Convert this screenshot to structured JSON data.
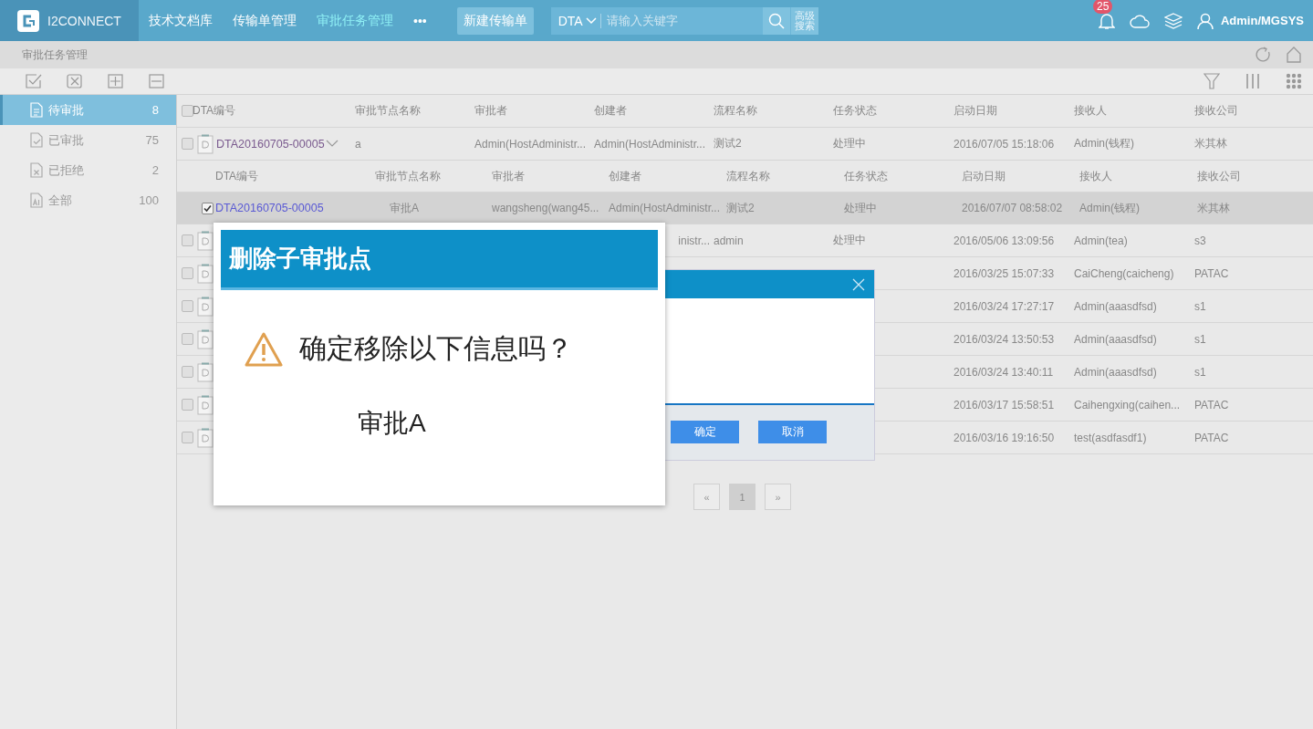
{
  "topbar": {
    "logo": "I2CONNECT",
    "nav": [
      {
        "label": "技术文档库",
        "selected": false
      },
      {
        "label": "传输单管理",
        "selected": false
      },
      {
        "label": "审批任务管理",
        "selected": true
      },
      {
        "label": "•••",
        "selected": false
      }
    ],
    "new_button": "新建传输单",
    "search": {
      "scope": "DTA",
      "placeholder": "请输入关键字",
      "advanced": "高级搜索"
    },
    "notification_count": "25",
    "user": "Admin/MGSYS"
  },
  "breadcrumb": "审批任务管理",
  "sidebar": {
    "items": [
      {
        "kind": "pending",
        "label": "待审批",
        "count": "8",
        "selected": true
      },
      {
        "kind": "approved",
        "label": "已审批",
        "count": "75",
        "selected": false
      },
      {
        "kind": "rejected",
        "label": "已拒绝",
        "count": "2",
        "selected": false
      },
      {
        "kind": "all",
        "label": "全部",
        "count": "100",
        "selected": false
      }
    ]
  },
  "table": {
    "select_all_checked": false,
    "columns": [
      "DTA编号",
      "审批节点名称",
      "审批者",
      "创建者",
      "流程名称",
      "任务状态",
      "启动日期",
      "接收人",
      "接收公司"
    ],
    "rows": [
      {
        "checked": false,
        "expanded": true,
        "id": "DTA20160705-00005",
        "node": "a",
        "approver": "Admin(HostAdministr...",
        "creator": "Admin(HostAdministr...",
        "process": "测试2",
        "status": "处理中",
        "date": "2016/07/05 15:18:06",
        "receiver": "Admin(钱程)",
        "company": "米其林",
        "detail": {
          "columns": [
            "DTA编号",
            "审批节点名称",
            "审批者",
            "创建者",
            "流程名称",
            "任务状态",
            "启动日期",
            "接收人",
            "接收公司"
          ],
          "rows": [
            {
              "checked": true,
              "selected": true,
              "id": "DTA20160705-00005",
              "node": "审批A",
              "approver": "wangsheng(wang45...",
              "creator": "Admin(HostAdministr...",
              "process": "测试2",
              "status": "处理中",
              "date": "2016/07/07 08:58:02",
              "receiver": "Admin(钱程)",
              "company": "米其林"
            }
          ]
        }
      },
      {
        "checked": false,
        "creator": "inistr...",
        "creator_cut": true,
        "process": "admin",
        "status": "处理中",
        "date": "2016/05/06 13:09:56",
        "receiver": "Admin(tea)",
        "company": "s3"
      },
      {
        "checked": false,
        "date": "2016/03/25 15:07:33",
        "receiver": "CaiCheng(caicheng)",
        "company": "PATAC"
      },
      {
        "checked": false,
        "date": "2016/03/24 17:27:17",
        "receiver": "Admin(aaasdfsd)",
        "company": "s1"
      },
      {
        "checked": false,
        "date": "2016/03/24 13:50:53",
        "receiver": "Admin(aaasdfsd)",
        "company": "s1"
      },
      {
        "checked": false,
        "date": "2016/03/24 13:40:11",
        "receiver": "Admin(aaasdfsd)",
        "company": "s1"
      },
      {
        "checked": false,
        "date": "2016/03/17 15:58:51",
        "receiver": "Caihengxing(caihen...",
        "company": "PATAC"
      },
      {
        "checked": false,
        "date": "2016/03/16 19:16:50",
        "receiver": "test(asdfasdf1)",
        "company": "PATAC"
      }
    ]
  },
  "pagination": {
    "prev": "«",
    "pages": [
      {
        "label": "1",
        "selected": true
      }
    ],
    "next": "»"
  },
  "confirm_dialog": {
    "buttons": [
      "确定",
      "取消"
    ]
  },
  "popup_image": {
    "title": "删除子审批点",
    "message": "确定移除以下信息吗？",
    "item": "审批A"
  }
}
